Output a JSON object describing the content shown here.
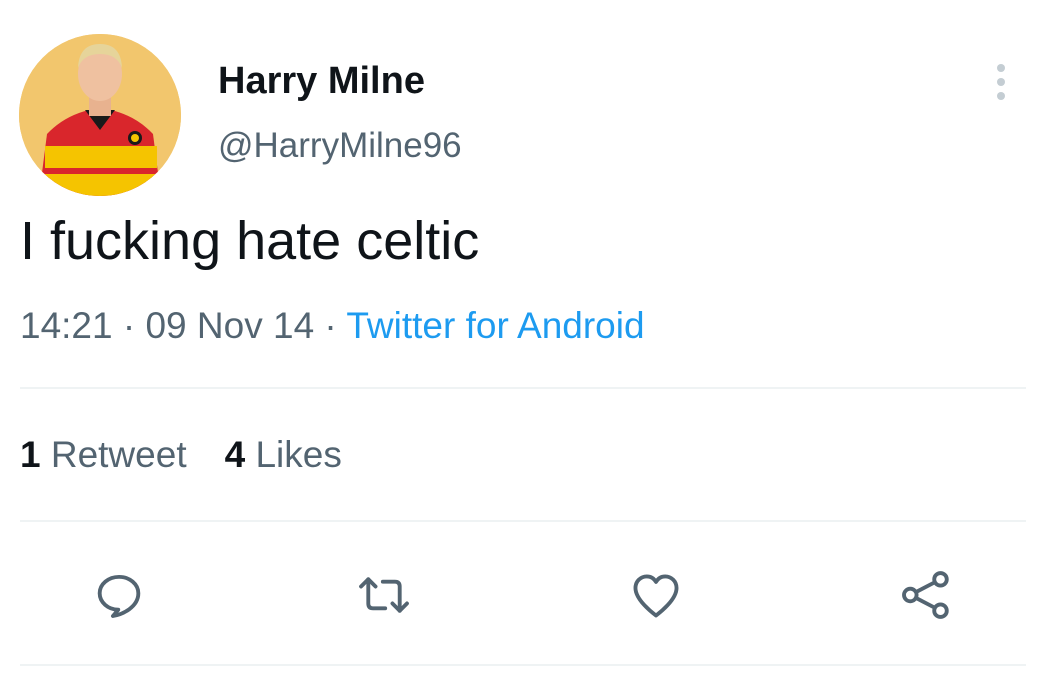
{
  "tweet": {
    "display_name": "Harry Milne",
    "handle": "@HarryMilne96",
    "text": "I fucking hate celtic",
    "time": "14:21",
    "separator": " · ",
    "date": "09 Nov 14",
    "source": "Twitter for Android",
    "stats": {
      "retweets_count": "1",
      "retweets_label": "Retweet",
      "likes_count": "4",
      "likes_label": "Likes"
    }
  },
  "icons": {
    "more": "more-vertical-icon",
    "reply": "reply-icon",
    "retweet": "retweet-icon",
    "like": "heart-icon",
    "share": "share-icon"
  },
  "colors": {
    "text_primary": "#0f1419",
    "text_secondary": "#536471",
    "link": "#1d9bf0",
    "divider": "#eff3f4",
    "avatar_bg": "#f2c66d"
  }
}
